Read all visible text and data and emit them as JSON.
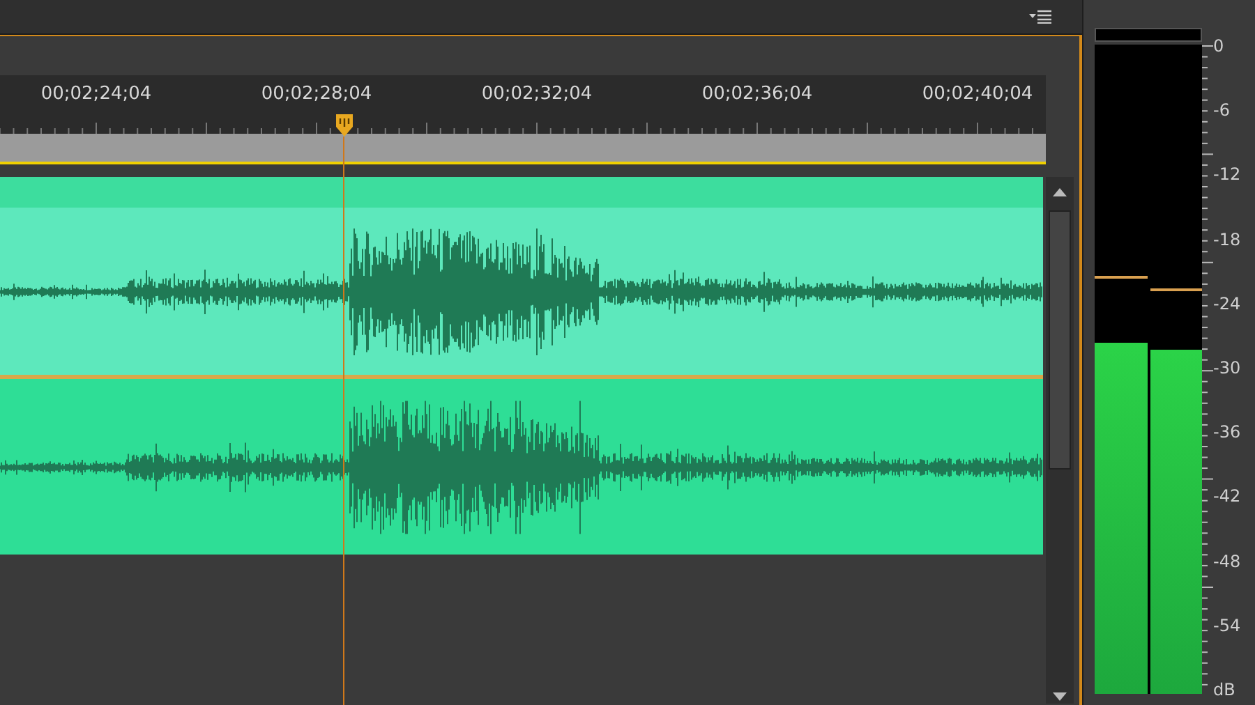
{
  "timeline": {
    "ticks": [
      "00;02;24;04",
      "00;02;28;04",
      "00;02;32;04",
      "00;02;36;04",
      "00;02;40;04"
    ]
  },
  "meter": {
    "channels": [
      {
        "level": 0.54,
        "peak": {
          "level": 0.64
        }
      },
      {
        "level": 0.53,
        "peak": {
          "level": 0.62
        }
      }
    ],
    "scale": [
      "0",
      "-6",
      "-12",
      "-18",
      "-24",
      "-30",
      "-36",
      "-42",
      "-48",
      "-54",
      "dB"
    ]
  }
}
